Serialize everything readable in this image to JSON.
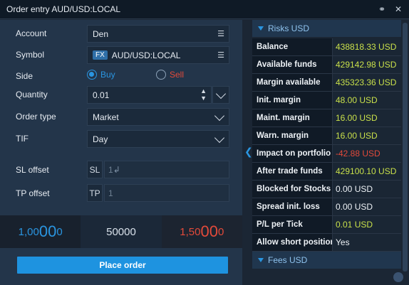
{
  "window": {
    "title": "Order entry AUD/USD:LOCAL"
  },
  "form": {
    "account": {
      "label": "Account",
      "value": "Den"
    },
    "symbol": {
      "label": "Symbol",
      "badge": "FX",
      "value": "AUD/USD:LOCAL"
    },
    "side": {
      "label": "Side",
      "buy": "Buy",
      "sell": "Sell",
      "selected": "Buy"
    },
    "quantity": {
      "label": "Quantity",
      "value": "0.01"
    },
    "order_type": {
      "label": "Order type",
      "value": "Market"
    },
    "tif": {
      "label": "TIF",
      "value": "Day"
    },
    "sl_offset": {
      "label": "SL offset",
      "prefix": "SL",
      "value": "1"
    },
    "tp_offset": {
      "label": "TP offset",
      "prefix": "TP",
      "value": "1"
    }
  },
  "quotes": {
    "bid": {
      "small1": "1,00",
      "big": "00",
      "small2": "0"
    },
    "mid": "50000",
    "ask": {
      "small1": "1,50",
      "big": "00",
      "small2": "0"
    }
  },
  "place_order": "Place order",
  "risks": {
    "header": "Risks USD",
    "rows": [
      {
        "k": "Balance",
        "v": "438818.33 USD"
      },
      {
        "k": "Available  funds",
        "v": "429142.98 USD"
      },
      {
        "k": "Margin available",
        "v": "435323.36 USD"
      },
      {
        "k": "Init. margin",
        "v": "48.00 USD"
      },
      {
        "k": "Maint. margin",
        "v": "16.00 USD"
      },
      {
        "k": "Warn. margin",
        "v": "16.00 USD"
      },
      {
        "k": "Impact on portfolio",
        "v": "-42.88 USD"
      },
      {
        "k": "After trade funds",
        "v": "429100.10 USD"
      },
      {
        "k": "Blocked for Stocks",
        "v": "0.00 USD"
      },
      {
        "k": "Spread init. loss",
        "v": "0.00 USD"
      },
      {
        "k": "P/L per Tick",
        "v": "0.01 USD"
      },
      {
        "k": "Allow short position",
        "v": "Yes"
      }
    ]
  },
  "fees": {
    "header": "Fees USD"
  },
  "colors": {
    "accent": "#1e93e0",
    "bid": "#2a95e0",
    "ask": "#e34a3a",
    "positive": "#c9e04a"
  }
}
